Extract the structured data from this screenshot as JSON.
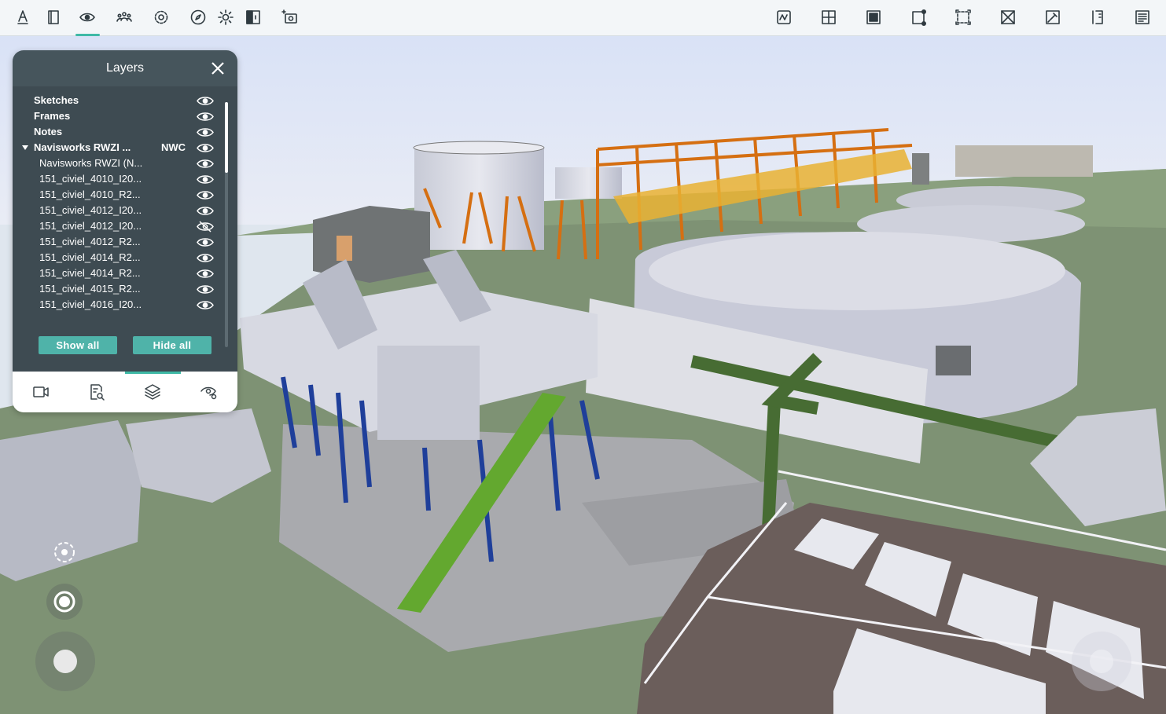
{
  "toolbar": {
    "left_icons": [
      "markup-icon",
      "sections-icon",
      "visibility-icon",
      "collaboration-icon",
      "settings-icon",
      "compass-icon",
      "lighting-icon",
      "split-view-icon",
      "camera-icon"
    ],
    "right_icons": [
      "measure-icon",
      "add-section-icon",
      "select-box-icon",
      "select-points-icon",
      "fit-view-icon",
      "clear-selection-icon",
      "pin-icon",
      "properties-icon",
      "notes-list-icon"
    ],
    "accent": "#3fb9a6"
  },
  "layers_panel": {
    "title": "Layers",
    "items": [
      {
        "label": "Sketches",
        "bold": true,
        "indent": 0,
        "tag": "",
        "visible": true
      },
      {
        "label": "Frames",
        "bold": true,
        "indent": 0,
        "tag": "",
        "visible": true
      },
      {
        "label": "Notes",
        "bold": true,
        "indent": 0,
        "tag": "",
        "visible": true
      },
      {
        "label": "Navisworks RWZI ...",
        "bold": true,
        "indent": 0,
        "tag": "NWC",
        "visible": true,
        "expanded": true
      },
      {
        "label": "Navisworks RWZI (N...",
        "bold": false,
        "indent": 1,
        "tag": "",
        "visible": true
      },
      {
        "label": "151_civiel_4010_I20...",
        "bold": false,
        "indent": 1,
        "tag": "",
        "visible": true
      },
      {
        "label": "151_civiel_4010_R2...",
        "bold": false,
        "indent": 1,
        "tag": "",
        "visible": true
      },
      {
        "label": "151_civiel_4012_I20...",
        "bold": false,
        "indent": 1,
        "tag": "",
        "visible": true
      },
      {
        "label": "151_civiel_4012_I20...",
        "bold": false,
        "indent": 1,
        "tag": "",
        "visible": false
      },
      {
        "label": "151_civiel_4012_R2...",
        "bold": false,
        "indent": 1,
        "tag": "",
        "visible": true
      },
      {
        "label": "151_civiel_4014_R2...",
        "bold": false,
        "indent": 1,
        "tag": "",
        "visible": true
      },
      {
        "label": "151_civiel_4014_R2...",
        "bold": false,
        "indent": 1,
        "tag": "",
        "visible": true
      },
      {
        "label": "151_civiel_4015_R2...",
        "bold": false,
        "indent": 1,
        "tag": "",
        "visible": true
      },
      {
        "label": "151_civiel_4016_I20...",
        "bold": false,
        "indent": 1,
        "tag": "",
        "visible": true
      }
    ],
    "show_all_label": "Show all",
    "hide_all_label": "Hide all",
    "footer_tabs": [
      "viewpoints-icon",
      "search-model-icon",
      "layers-icon",
      "visibility-settings-icon"
    ],
    "active_footer_tab": "layers-icon"
  },
  "navigation": {
    "controls": [
      "orbit-icon",
      "walk-mode-icon",
      "move-joystick",
      "look-joystick"
    ]
  }
}
